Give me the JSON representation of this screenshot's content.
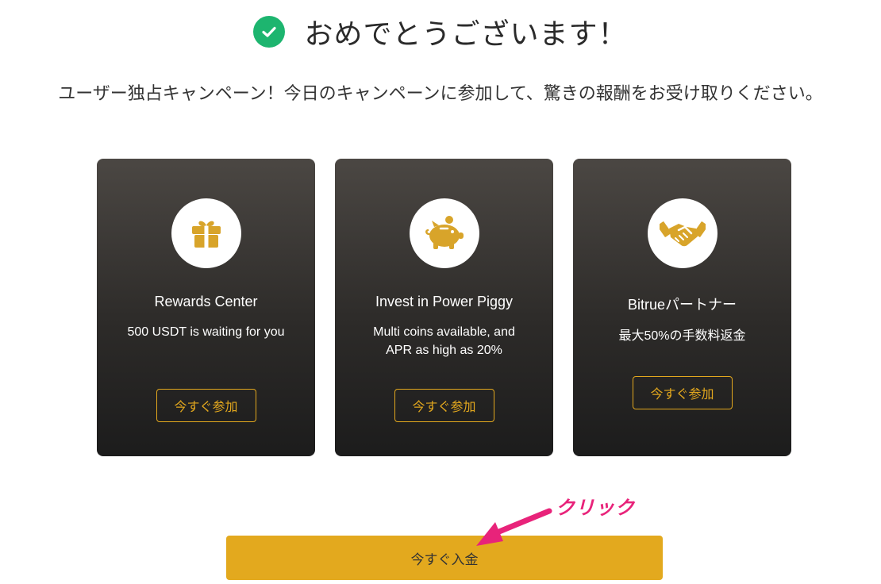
{
  "header": {
    "check_icon": "check-circle-icon",
    "check_color": "#1db56f",
    "title": "おめでとうございます！"
  },
  "subtitle": "ユーザー独占キャンペーン！今日のキャンペーンに参加して、驚きの報酬をお受け取りください。",
  "cards": [
    {
      "icon": "gift-icon",
      "title": "Rewards Center",
      "description": "500 USDT is waiting for you",
      "button_label": "今すぐ参加"
    },
    {
      "icon": "piggy-bank-icon",
      "title": "Invest in Power Piggy",
      "description": "Multi coins available, and APR as high as 20%",
      "button_label": "今すぐ参加"
    },
    {
      "icon": "handshake-icon",
      "title": "Bitrueパートナー",
      "description": "最大50%の手数料返金",
      "button_label": "今すぐ参加"
    }
  ],
  "deposit_button": {
    "label": "今すぐ入金"
  },
  "annotation": {
    "label": "クリック",
    "color": "#e8237a"
  },
  "colors": {
    "accent": "#e3a91e",
    "card_top": "#4b4743",
    "card_bottom": "#1c1c1c"
  }
}
